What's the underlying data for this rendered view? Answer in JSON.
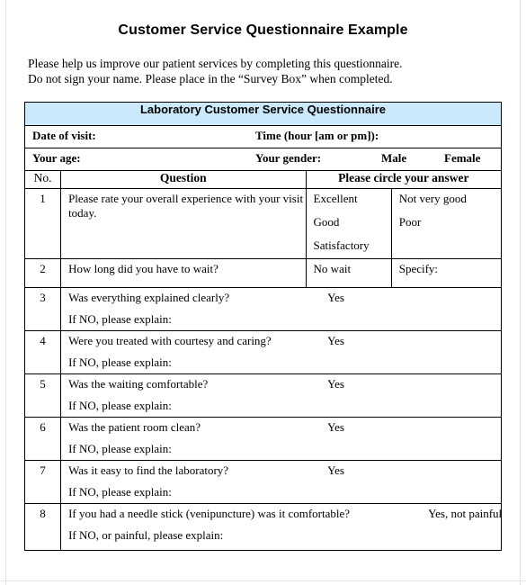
{
  "document": {
    "title": "Customer Service Questionnaire Example",
    "intro_line_1": "Please help us improve our patient services by completing this questionnaire.",
    "intro_line_2": "Do not sign your name.  Please place in the “Survey Box” when completed."
  },
  "colors": {
    "banner_background": "#cbe9fb",
    "border": "#000000",
    "text": "#000000",
    "page_background": "#ffffff"
  },
  "table": {
    "banner_title": "Laboratory Customer Service Questionnaire",
    "info_rows": [
      {
        "label_left": "Date of visit:",
        "label_right": "Time (hour [am or pm]):"
      },
      {
        "label_left": "Your age:",
        "label_right": "Your gender:",
        "option_male": "Male",
        "option_female": "Female"
      }
    ],
    "column_headers": {
      "number": "No.",
      "question": "Question",
      "answer": "Please circle your answer"
    },
    "rows": [
      {
        "no": "1",
        "question": "Please rate your overall experience with your visit today.",
        "answers_col1": [
          "Excellent",
          "Good",
          "Satisfactory"
        ],
        "answers_col2": [
          "Not very good",
          "Poor"
        ]
      },
      {
        "no": "2",
        "question": "How long did you have to wait?",
        "answers_col1": [
          "No wait"
        ],
        "answers_col2": [
          "Specify:"
        ]
      },
      {
        "no": "3",
        "question": "Was everything explained clearly?",
        "answer": "Yes",
        "explain": "If NO, please explain:"
      },
      {
        "no": "4",
        "question": "Were you treated with courtesy and caring?",
        "answer": "Yes",
        "explain": "If NO, please explain:"
      },
      {
        "no": "5",
        "question": "Was the waiting comfortable?",
        "answer": "Yes",
        "explain": "If NO, please explain:"
      },
      {
        "no": "6",
        "question": "Was the patient room clean?",
        "answer": "Yes",
        "explain": "If NO, please explain:"
      },
      {
        "no": "7",
        "question": "Was it easy to find the laboratory?",
        "answer": "Yes",
        "explain": "If NO, please explain:"
      },
      {
        "no": "8",
        "question": "If you had a needle stick (venipuncture) was it comfortable?",
        "answer": "Yes, not painful",
        "explain": "If NO, or painful, please explain:"
      }
    ]
  }
}
